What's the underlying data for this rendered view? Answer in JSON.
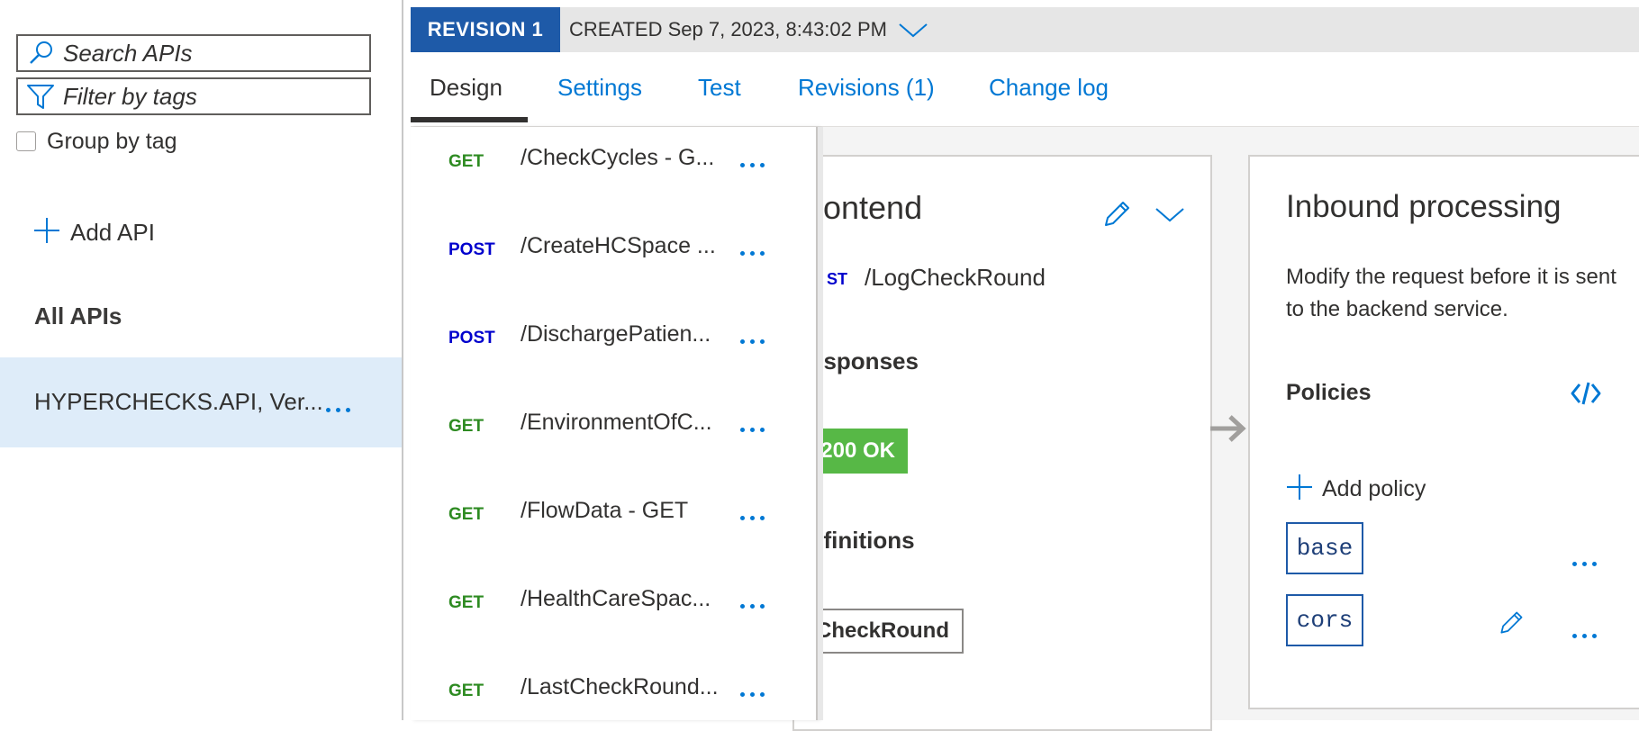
{
  "left_pane": {
    "search_placeholder": "Search APIs",
    "filter_placeholder": "Filter by tags",
    "group_by_tag_label": "Group by tag",
    "add_api_label": "Add API",
    "all_apis_heading": "All APIs",
    "apis": [
      {
        "name": "HYPERCHECKS.API, Ver..."
      }
    ]
  },
  "revision": {
    "badge": "REVISION 1",
    "created": "CREATED Sep 7, 2023, 8:43:02 PM"
  },
  "tabs": [
    {
      "label": "Design",
      "active": true
    },
    {
      "label": "Settings"
    },
    {
      "label": "Test"
    },
    {
      "label": "Revisions (1)"
    },
    {
      "label": "Change log"
    }
  ],
  "operations": [
    {
      "method": "GET",
      "path": "/CheckCycles - G..."
    },
    {
      "method": "POST",
      "path": "/CreateHCSpace ..."
    },
    {
      "method": "POST",
      "path": "/DischargePatien..."
    },
    {
      "method": "GET",
      "path": "/EnvironmentOfC..."
    },
    {
      "method": "GET",
      "path": "/FlowData - GET"
    },
    {
      "method": "GET",
      "path": "/HealthCareSpac..."
    },
    {
      "method": "GET",
      "path": "/LastCheckRound..."
    }
  ],
  "frontend": {
    "title": "rontend",
    "method": "ST",
    "path": "/LogCheckRound",
    "responses_heading": "esponses",
    "response_badge": "200 OK",
    "definitions_heading": "efinitions",
    "definition_chip": "CheckRound"
  },
  "inbound": {
    "title": "Inbound processing",
    "description": "Modify the request before it is sent to the backend service.",
    "policies_heading": "Policies",
    "add_policy_label": "Add policy",
    "policies": [
      "base",
      "cors"
    ]
  },
  "colors": {
    "accent": "#0078d4",
    "revision_badge": "#1e5aa8",
    "get_method": "#2e8b22",
    "post_method": "#0000cd",
    "ok_badge": "#57b846",
    "selected_row": "#deecf9"
  }
}
